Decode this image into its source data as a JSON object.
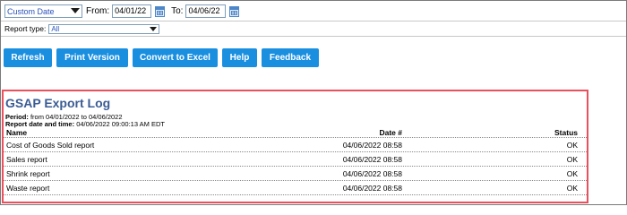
{
  "filters": {
    "range_select": "Custom Date",
    "from_label": "From:",
    "from_value": "04/01/22",
    "to_label": "To:",
    "to_value": "04/06/22",
    "report_type_label": "Report type:",
    "report_type_value": "All"
  },
  "toolbar": {
    "refresh": "Refresh",
    "print": "Print Version",
    "excel": "Convert to Excel",
    "help": "Help",
    "feedback": "Feedback"
  },
  "report": {
    "title": "GSAP Export Log",
    "period_label": "Period:",
    "period_value": "from 04/01/2022 to 04/06/2022",
    "datetime_label": "Report date and time:",
    "datetime_value": "04/06/2022 09:00:13 AM EDT",
    "columns": {
      "name": "Name",
      "date": "Date #",
      "status": "Status"
    },
    "rows": [
      {
        "name": "Cost of Goods Sold report",
        "date": "04/06/2022 08:58",
        "status": "OK"
      },
      {
        "name": "Sales report",
        "date": "04/06/2022 08:58",
        "status": "OK"
      },
      {
        "name": "Shrink report",
        "date": "04/06/2022 08:58",
        "status": "OK"
      },
      {
        "name": "Waste report",
        "date": "04/06/2022 08:58",
        "status": "OK"
      }
    ]
  },
  "colors": {
    "button_bg": "#1a8fe0",
    "title": "#3b5c94",
    "highlight_border": "#e8515d"
  }
}
